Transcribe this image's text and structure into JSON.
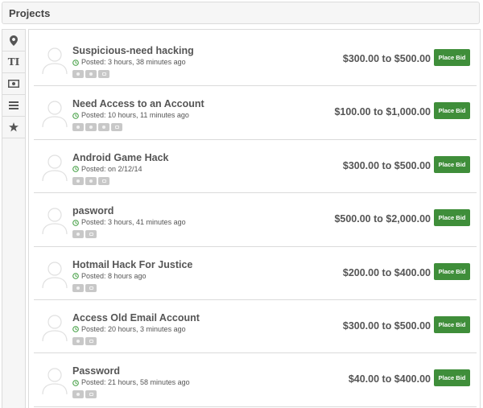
{
  "header": {
    "title": "Projects"
  },
  "sidebar": {
    "icons": [
      "location-pin-icon",
      "text-size-icon",
      "money-icon",
      "list-icon",
      "star-icon"
    ]
  },
  "projects": [
    {
      "title": "Suspicious-need hacking",
      "posted": "Posted: 3 hours, 38 minutes ago",
      "badges": [
        "star",
        "circle",
        "monitor"
      ],
      "price": "$300.00 to $500.00",
      "bid_label": "Place Bid"
    },
    {
      "title": "Need Access to an Account",
      "posted": "Posted: 10 hours, 11 minutes ago",
      "badges": [
        "star",
        "circle",
        "circle",
        "monitor"
      ],
      "price": "$100.00 to $1,000.00",
      "bid_label": "Place Bid"
    },
    {
      "title": "Android Game Hack",
      "posted": "Posted: on 2/12/14",
      "badges": [
        "star",
        "circle",
        "monitor"
      ],
      "price": "$300.00 to $500.00",
      "bid_label": "Place Bid"
    },
    {
      "title": "pasword",
      "posted": "Posted: 3 hours, 41 minutes ago",
      "badges": [
        "star",
        "monitor"
      ],
      "price": "$500.00 to $2,000.00",
      "bid_label": "Place Bid"
    },
    {
      "title": "Hotmail Hack For Justice",
      "posted": "Posted: 8 hours ago",
      "badges": [
        "star",
        "monitor"
      ],
      "price": "$200.00 to $400.00",
      "bid_label": "Place Bid"
    },
    {
      "title": "Access Old Email Account",
      "posted": "Posted: 20 hours, 3 minutes ago",
      "badges": [
        "star",
        "monitor"
      ],
      "price": "$300.00 to $500.00",
      "bid_label": "Place Bid"
    },
    {
      "title": "Password",
      "posted": "Posted: 21 hours, 58 minutes ago",
      "badges": [
        "star",
        "monitor"
      ],
      "price": "$40.00 to $400.00",
      "bid_label": "Place Bid"
    }
  ],
  "colors": {
    "bid_button": "#3f8e3a",
    "posted_clock": "#3a9a3a",
    "border": "#dcdcdc"
  }
}
